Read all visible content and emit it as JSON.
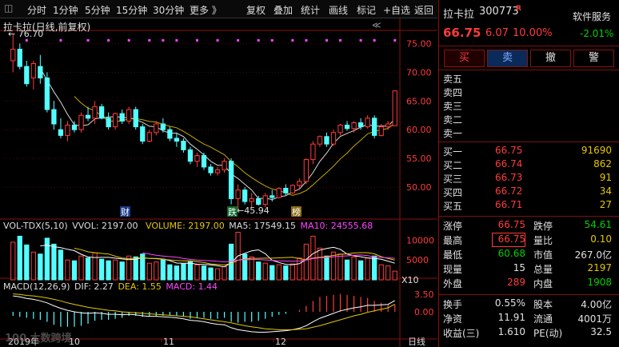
{
  "toolbar": {
    "items": [
      "分时",
      "1分钟",
      "5分钟",
      "15分钟",
      "30分钟",
      "更多 》",
      "复权",
      "叠加",
      "统计",
      "画线",
      "标记",
      "+自选",
      "返回"
    ]
  },
  "chart": {
    "title": "拉卡拉(日线,前复权)",
    "high_marker": "76.70",
    "low_marker": "45.94",
    "price_ticks": [
      "75.00",
      "70.00",
      "65.00",
      "60.00",
      "55.00",
      "50.00"
    ],
    "event_labels": [
      "财",
      "跌",
      "榜"
    ],
    "volume_header": {
      "name": "VOL-TDX(5,10)",
      "vvol": "VVOL: 2197.00",
      "volume": "VOLUME: 2197.00",
      "ma5": "MA5: 17549.15",
      "ma10": "MA10: 24555.68"
    },
    "volume_ticks": [
      "10000",
      "5000"
    ],
    "volume_unit": "X10",
    "macd_header": {
      "name": "MACD(12,26,9)",
      "dif": "DIF: 2.27",
      "dea": "DEA: 1.55",
      "macd": "MACD: 1.44"
    },
    "macd_ticks": [
      "3.50",
      "0.00"
    ],
    "date_labels": [
      "2019年",
      "10",
      "11",
      "12"
    ],
    "period_label": "日线",
    "watermark": "100 大数跨境",
    "colors": {
      "up": "#ff3b3b",
      "down": "#54ffff",
      "ma5": "#ffffff",
      "ma10": "#e6c700",
      "ma_purple": "#ff44ff"
    }
  },
  "panel": {
    "stock_name": "拉卡拉",
    "stock_code": "300773",
    "flag": "R",
    "price": "66.75",
    "change": "6.07",
    "change_pct": "10.00%",
    "service_label": "软件服务",
    "service_change": "-2.01%",
    "buttons": [
      "买",
      "卖",
      "撤",
      "警"
    ],
    "sell_rows": [
      "卖五",
      "卖四",
      "卖三",
      "卖二",
      "卖一"
    ],
    "buy_rows": [
      {
        "label": "买一",
        "price": "66.75",
        "vol": "91690"
      },
      {
        "label": "买二",
        "price": "66.74",
        "vol": "862"
      },
      {
        "label": "买三",
        "price": "66.73",
        "vol": "91"
      },
      {
        "label": "买四",
        "price": "66.72",
        "vol": "34"
      },
      {
        "label": "买五",
        "price": "66.71",
        "vol": "27"
      }
    ],
    "stats": [
      {
        "l1": "涨停",
        "v1": "66.75",
        "l2": "跌停",
        "v2": "54.61"
      },
      {
        "l1": "最高",
        "v1": "66.75",
        "l2": "量比",
        "v2": "0.10"
      },
      {
        "l1": "最低",
        "v1": "60.68",
        "l2": "市值",
        "v2": "267.0亿"
      },
      {
        "l1": "现量",
        "v1": "15",
        "l2": "总量",
        "v2": "2197"
      },
      {
        "l1": "外盘",
        "v1": "289",
        "l2": "内盘",
        "v2": "1908"
      }
    ],
    "stats2": [
      {
        "l1": "换手",
        "v1": "0.55%",
        "l2": "股本",
        "v2": "4.00亿"
      },
      {
        "l1": "净资",
        "v1": "11.91",
        "l2": "流通",
        "v2": "4001万"
      },
      {
        "l1": "收益(三)",
        "v1": "1.610",
        "l2": "PE(动)",
        "v2": "32.5"
      }
    ]
  },
  "chart_data": {
    "type": "candlestick",
    "price_axis": [
      45,
      77
    ],
    "candles": [
      [
        72,
        76.7,
        70,
        74
      ],
      [
        74,
        75,
        70.5,
        71
      ],
      [
        71,
        72,
        67.5,
        68
      ],
      [
        69,
        72,
        67,
        71.5
      ],
      [
        71,
        73,
        68,
        69
      ],
      [
        69,
        70,
        63,
        63.5
      ],
      [
        63.5,
        65,
        60,
        61
      ],
      [
        60,
        62,
        58.5,
        59
      ],
      [
        59,
        61.5,
        58,
        60.8
      ],
      [
        60.8,
        61.5,
        59.5,
        60
      ],
      [
        60,
        63,
        59.5,
        62.5
      ],
      [
        62.5,
        64,
        61.5,
        62
      ],
      [
        62,
        65,
        61,
        64
      ],
      [
        64,
        64.5,
        61.8,
        62
      ],
      [
        62,
        63,
        60,
        60.5
      ],
      [
        60.5,
        63,
        60,
        62.8
      ],
      [
        62.8,
        63.5,
        61,
        61.5
      ],
      [
        61.5,
        64,
        61,
        63.5
      ],
      [
        63.5,
        64,
        60,
        60.5
      ],
      [
        60.5,
        61,
        57.5,
        58
      ],
      [
        58,
        60,
        57.8,
        59.5
      ],
      [
        59.5,
        61.5,
        59,
        61
      ],
      [
        61,
        62,
        59.5,
        60
      ],
      [
        60,
        60.5,
        58,
        58.5
      ],
      [
        58.5,
        59.5,
        57,
        58
      ],
      [
        58,
        58.5,
        56,
        56.5
      ],
      [
        56.5,
        57,
        54,
        54.5
      ],
      [
        54.5,
        56,
        53.5,
        55.5
      ],
      [
        55.5,
        56,
        53,
        53.5
      ],
      [
        53.5,
        54,
        52,
        52.5
      ],
      [
        52.5,
        53.5,
        52,
        53
      ],
      [
        53,
        55,
        52.5,
        54.5
      ],
      [
        54.5,
        55,
        47,
        48
      ],
      [
        48,
        50.5,
        45.94,
        49.5
      ],
      [
        49.5,
        50,
        47,
        47.5
      ],
      [
        47.5,
        49,
        46.5,
        48
      ],
      [
        48,
        48.5,
        46.8,
        47
      ],
      [
        47,
        49,
        46.5,
        48.5
      ],
      [
        48.5,
        49.5,
        47.5,
        48.2
      ],
      [
        48.2,
        50,
        48,
        49.8
      ],
      [
        49.8,
        50.5,
        48.5,
        49
      ],
      [
        49,
        50.5,
        48.8,
        50.3
      ],
      [
        50.3,
        51.5,
        49.5,
        51
      ],
      [
        51,
        55,
        50.5,
        54.8
      ],
      [
        54.8,
        58,
        54,
        57.5
      ],
      [
        57.5,
        59,
        57,
        58.8
      ],
      [
        58.8,
        59.5,
        57,
        57.5
      ],
      [
        57.5,
        60,
        57.2,
        59.5
      ],
      [
        59.5,
        61,
        59,
        60.8
      ],
      [
        60.8,
        61.5,
        59.8,
        60.2
      ],
      [
        60.2,
        61.5,
        59.5,
        61.2
      ],
      [
        61.2,
        62,
        60,
        60.5
      ],
      [
        60.5,
        62.5,
        60.2,
        62
      ],
      [
        62,
        62.5,
        58.5,
        59
      ],
      [
        59,
        61,
        58.8,
        60.5
      ],
      [
        60.5,
        61.5,
        60,
        61
      ],
      [
        60.68,
        66.75,
        60.68,
        66.75
      ]
    ],
    "volumes": [
      9500,
      11000,
      8800,
      7000,
      6500,
      10500,
      9000,
      7500,
      5000,
      4800,
      6000,
      5500,
      6800,
      5200,
      4800,
      5000,
      4500,
      6000,
      5800,
      6500,
      4200,
      4500,
      5200,
      3800,
      3500,
      4000,
      4600,
      3800,
      3500,
      3000,
      2800,
      3300,
      9000,
      12000,
      6500,
      5800,
      4500,
      4200,
      3600,
      3800,
      3500,
      4000,
      5500,
      9000,
      11000,
      8000,
      6000,
      7000,
      6500,
      5000,
      5800,
      4800,
      5500,
      6000,
      3800,
      3500,
      2197
    ],
    "dif": [
      3.2,
      3.0,
      2.7,
      2.5,
      2.2,
      1.8,
      1.2,
      0.7,
      0.3,
      0.0,
      -0.2,
      -0.3,
      -0.2,
      -0.3,
      -0.5,
      -0.5,
      -0.6,
      -0.5,
      -0.6,
      -0.8,
      -0.9,
      -0.9,
      -1.0,
      -1.1,
      -1.2,
      -1.4,
      -1.7,
      -1.8,
      -2.0,
      -2.3,
      -2.5,
      -2.6,
      -3.2,
      -3.6,
      -3.8,
      -4.0,
      -4.1,
      -4.1,
      -4.0,
      -3.9,
      -3.8,
      -3.6,
      -3.3,
      -2.8,
      -2.0,
      -1.3,
      -0.8,
      -0.3,
      0.2,
      0.5,
      0.8,
      1.0,
      1.3,
      1.3,
      1.4,
      1.5,
      2.27
    ],
    "dea": [
      3.6,
      3.5,
      3.3,
      3.2,
      3.0,
      2.8,
      2.5,
      2.2,
      1.8,
      1.5,
      1.2,
      0.9,
      0.7,
      0.5,
      0.3,
      0.2,
      0.0,
      -0.1,
      -0.2,
      -0.3,
      -0.4,
      -0.5,
      -0.6,
      -0.7,
      -0.8,
      -0.9,
      -1.0,
      -1.2,
      -1.4,
      -1.6,
      -1.8,
      -2.0,
      -2.2,
      -2.5,
      -2.8,
      -3.0,
      -3.2,
      -3.4,
      -3.5,
      -3.6,
      -3.6,
      -3.6,
      -3.5,
      -3.4,
      -3.1,
      -2.8,
      -2.4,
      -2.0,
      -1.6,
      -1.2,
      -0.8,
      -0.5,
      -0.1,
      0.2,
      0.5,
      0.8,
      1.55
    ]
  }
}
